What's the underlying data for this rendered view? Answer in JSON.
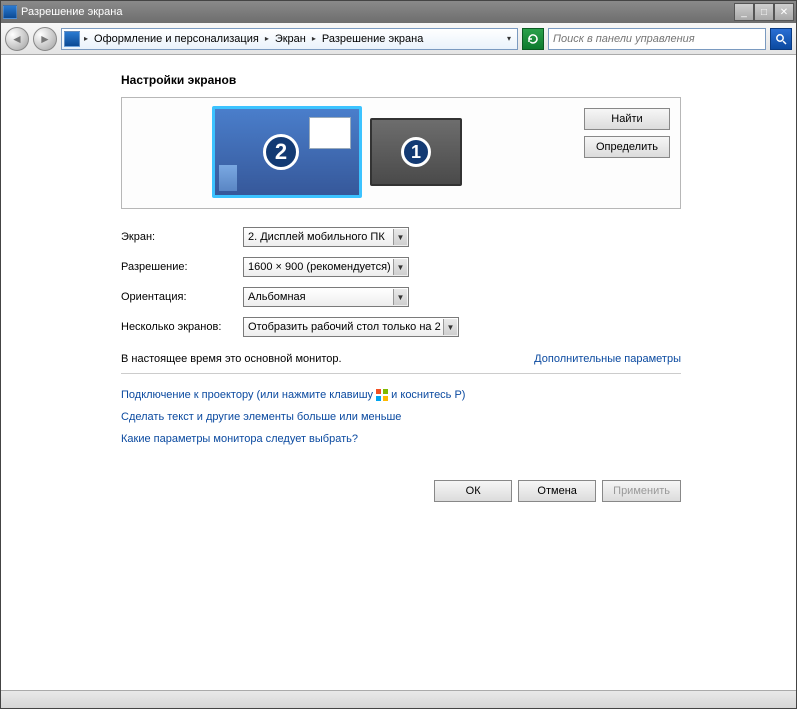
{
  "titlebar": {
    "title": "Разрешение экрана"
  },
  "breadcrumb": {
    "items": [
      "Оформление и персонализация",
      "Экран",
      "Разрешение экрана"
    ]
  },
  "search": {
    "placeholder": "Поиск в панели управления"
  },
  "heading": "Настройки экранов",
  "side_buttons": {
    "find": "Найти",
    "detect": "Определить"
  },
  "monitors": {
    "mon2": "2",
    "mon1": "1"
  },
  "form": {
    "screen_label": "Экран:",
    "screen_value": "2. Дисплей мобильного ПК",
    "resolution_label": "Разрешение:",
    "resolution_value": "1600 × 900 (рекомендуется)",
    "orientation_label": "Ориентация:",
    "orientation_value": "Альбомная",
    "multi_label": "Несколько экранов:",
    "multi_value": "Отобразить рабочий стол только на 2"
  },
  "primary_text": "В настоящее время это основной монитор.",
  "advanced_link": "Дополнительные параметры",
  "links": {
    "projector_pre": "Подключение к проектору (или нажмите клавишу ",
    "projector_post": " и коснитесь P)",
    "text_size": "Сделать текст и другие элементы больше или меньше",
    "which_params": "Какие параметры монитора следует выбрать?"
  },
  "buttons": {
    "ok": "ОК",
    "cancel": "Отмена",
    "apply": "Применить"
  }
}
